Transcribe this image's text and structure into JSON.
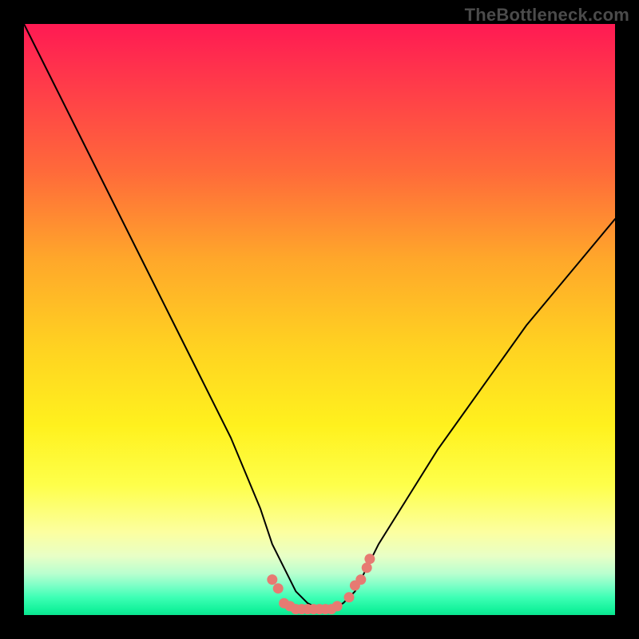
{
  "watermark": "TheBottleneck.com",
  "chart_data": {
    "type": "line",
    "title": "",
    "xlabel": "",
    "ylabel": "",
    "x": [
      0,
      5,
      10,
      15,
      20,
      25,
      30,
      35,
      40,
      42,
      44,
      46,
      48,
      50,
      52,
      54,
      56,
      58,
      60,
      65,
      70,
      75,
      80,
      85,
      90,
      95,
      100
    ],
    "values": [
      100,
      90,
      80,
      70,
      60,
      50,
      40,
      30,
      18,
      12,
      8,
      4,
      2,
      1,
      1,
      2,
      4,
      8,
      12,
      20,
      28,
      35,
      42,
      49,
      55,
      61,
      67
    ],
    "xlim": [
      0,
      100
    ],
    "ylim": [
      0,
      100
    ],
    "series_name": "bottleneck curve",
    "marker_cluster": {
      "description": "small salmon dots clustered near the curve minimum",
      "points": [
        {
          "x": 42,
          "y": 6
        },
        {
          "x": 43,
          "y": 4.5
        },
        {
          "x": 44,
          "y": 2
        },
        {
          "x": 45,
          "y": 1.5
        },
        {
          "x": 46,
          "y": 1
        },
        {
          "x": 47,
          "y": 1
        },
        {
          "x": 48,
          "y": 1
        },
        {
          "x": 49,
          "y": 1
        },
        {
          "x": 50,
          "y": 1
        },
        {
          "x": 51,
          "y": 1
        },
        {
          "x": 52,
          "y": 1
        },
        {
          "x": 53,
          "y": 1.5
        },
        {
          "x": 55,
          "y": 3
        },
        {
          "x": 56,
          "y": 5
        },
        {
          "x": 57,
          "y": 6
        },
        {
          "x": 58,
          "y": 8
        },
        {
          "x": 58.5,
          "y": 9.5
        }
      ],
      "color": "#e77a72"
    }
  }
}
